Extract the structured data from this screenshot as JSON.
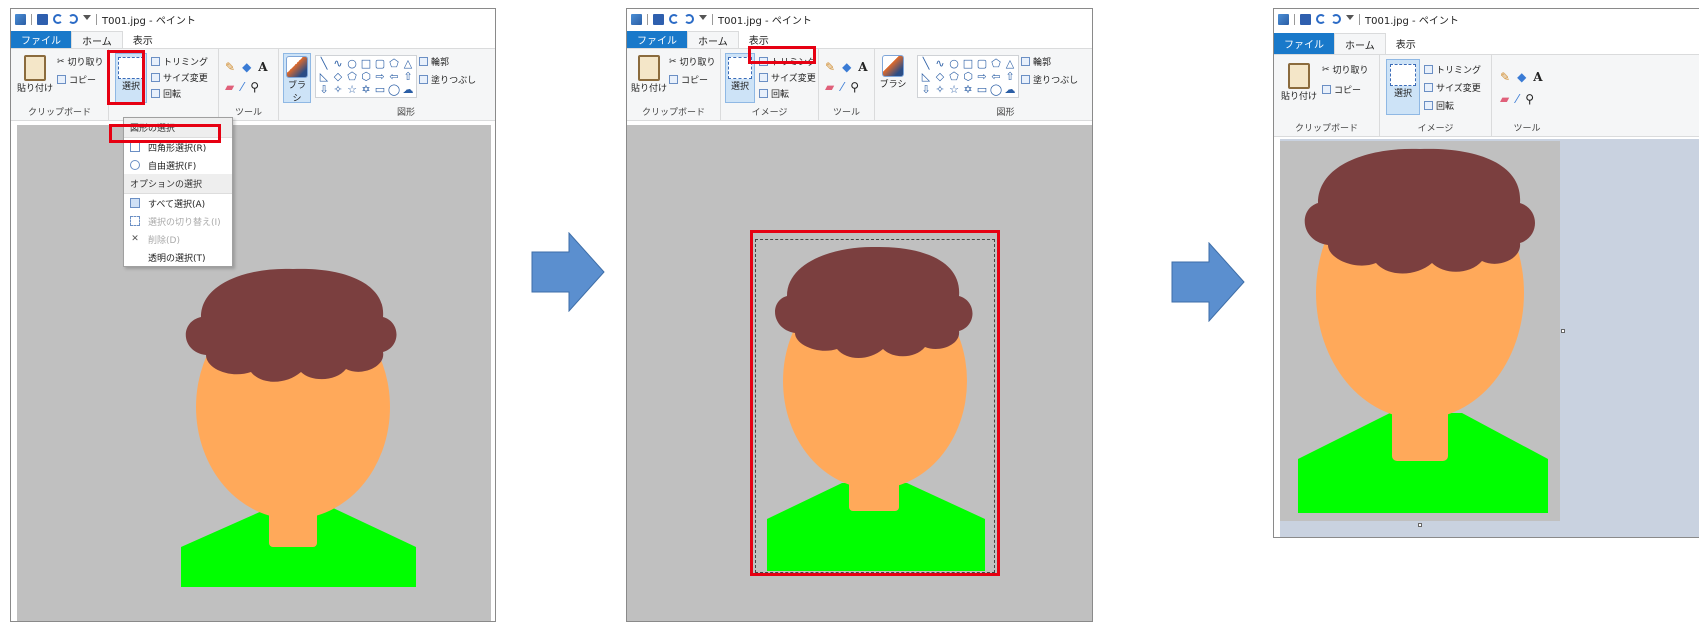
{
  "window_title": "T001.jpg - ペイント",
  "tabs": {
    "file": "ファイル",
    "home": "ホーム",
    "view": "表示"
  },
  "ribbon": {
    "paste": "貼り付け",
    "cut": "切り取り",
    "copy": "コピー",
    "clipboard_group": "クリップボード",
    "select": "選択",
    "crop": "トリミング",
    "resize": "サイズ変更",
    "rotate": "回転",
    "image_group": "イメージ",
    "tools_group": "ツール",
    "brush": "ブラシ",
    "outline": "輪郭",
    "fill": "塗りつぶし",
    "shapes_group": "図形"
  },
  "select_menu": {
    "shape_header": "図形の選択",
    "rect_select": "四角形選択(R)",
    "free_select": "自由選択(F)",
    "option_header": "オプションの選択",
    "select_all": "すべて選択(A)",
    "invert_select": "選択の切り替え(I)",
    "delete": "削除(D)",
    "transparent_select": "透明の選択(T)"
  },
  "colors": {
    "highlight": "#e60012",
    "arrow": "#5b8fcf",
    "canvas_bg": "#c0c0c0",
    "hair": "#7b3f3f",
    "face": "#ffa95a",
    "shirt": "#00ff00"
  },
  "icons": [
    "app-icon",
    "save-icon",
    "undo-icon",
    "redo-icon",
    "pencil-icon",
    "fill-bucket-icon",
    "text-icon",
    "eraser-icon",
    "color-picker-icon",
    "magnifier-icon",
    "brush-icon"
  ]
}
